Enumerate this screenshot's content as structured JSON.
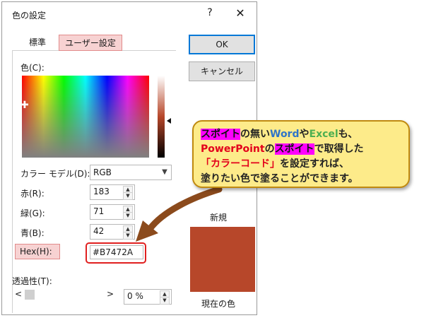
{
  "dialog": {
    "title": "色の設定",
    "help_label": "?",
    "close_label": "✕"
  },
  "tabs": {
    "standard": "標準",
    "custom": "ユーザー設定"
  },
  "color_label": "色(C):",
  "model": {
    "label": "カラー モデル(D):",
    "value": "RGB"
  },
  "red": {
    "label": "赤(R):",
    "value": "183"
  },
  "green": {
    "label": "緑(G):",
    "value": "71"
  },
  "blue": {
    "label": "青(B):",
    "value": "42"
  },
  "hex": {
    "label": "Hex(H):",
    "value": "#B7472A"
  },
  "transparency": {
    "label": "透過性(T):",
    "left_arrow": "<",
    "right_arrow": ">",
    "value": "0 %"
  },
  "buttons": {
    "ok": "OK",
    "cancel": "キャンセル"
  },
  "preview": {
    "new_label": "新規",
    "current_label": "現在の色",
    "new_color": "#B7472A",
    "current_color": "#B7472A"
  },
  "callout": {
    "l1_a": "スポイト",
    "l1_b": "の無い",
    "l1_c": "Word",
    "l1_d": "や",
    "l1_e": "Excel",
    "l1_f": "も、",
    "l2_a": "PowerPoint",
    "l2_b": "の",
    "l2_c": "スポイト",
    "l2_d": "で取得した",
    "l3_a": "「カラーコード」",
    "l3_b": "を設定すれば、",
    "l4": "塗りたい色で塗ることができます。"
  },
  "colors": {
    "accent_pink": "#F7D2D2",
    "highlight_red": "#E02020",
    "callout_bg": "#FDEB8A",
    "arrow": "#8B4A1C"
  }
}
